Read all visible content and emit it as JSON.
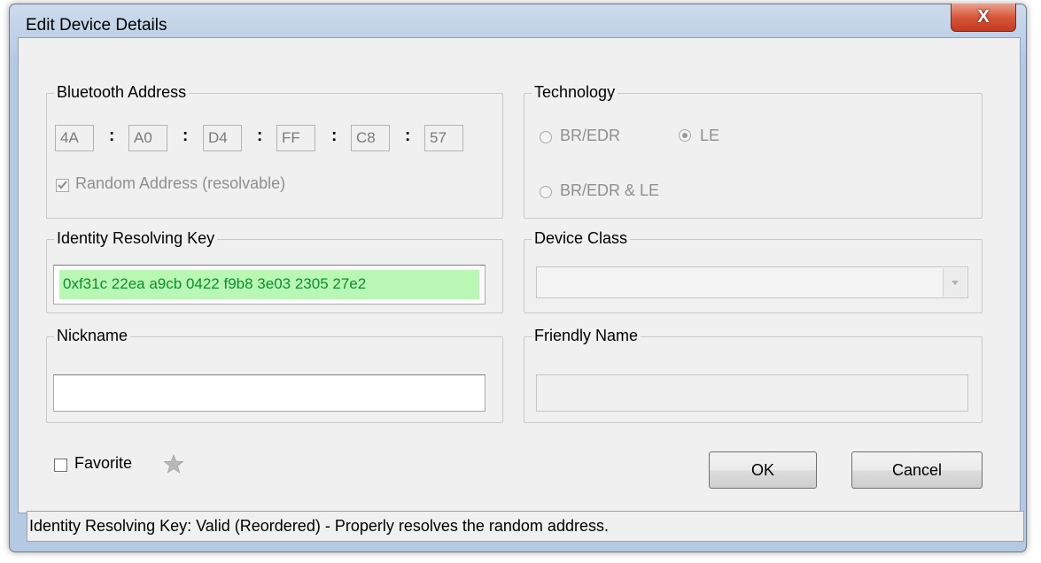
{
  "window": {
    "title": "Edit Device Details",
    "close_label": "X"
  },
  "bluetooth_address": {
    "label": "Bluetooth Address",
    "bytes": [
      "4A",
      "A0",
      "D4",
      "FF",
      "C8",
      "57"
    ],
    "separator": ":",
    "random_label": "Random Address (resolvable)",
    "random_checked": true
  },
  "technology": {
    "label": "Technology",
    "options": [
      "BR/EDR",
      "LE",
      "BR/EDR & LE"
    ],
    "selected": "LE"
  },
  "irk": {
    "label": "Identity Resolving Key",
    "value": "0xf31c 22ea a9cb 0422 f9b8 3e03 2305 27e2",
    "valid_color": "#b9f7b5"
  },
  "device_class": {
    "label": "Device Class",
    "value": ""
  },
  "nickname": {
    "label": "Nickname",
    "value": ""
  },
  "friendly_name": {
    "label": "Friendly Name",
    "value": ""
  },
  "favorite": {
    "label": "Favorite",
    "checked": false
  },
  "buttons": {
    "ok": "OK",
    "cancel": "Cancel"
  },
  "status": "Identity Resolving Key: Valid (Reordered) - Properly resolves the random address."
}
